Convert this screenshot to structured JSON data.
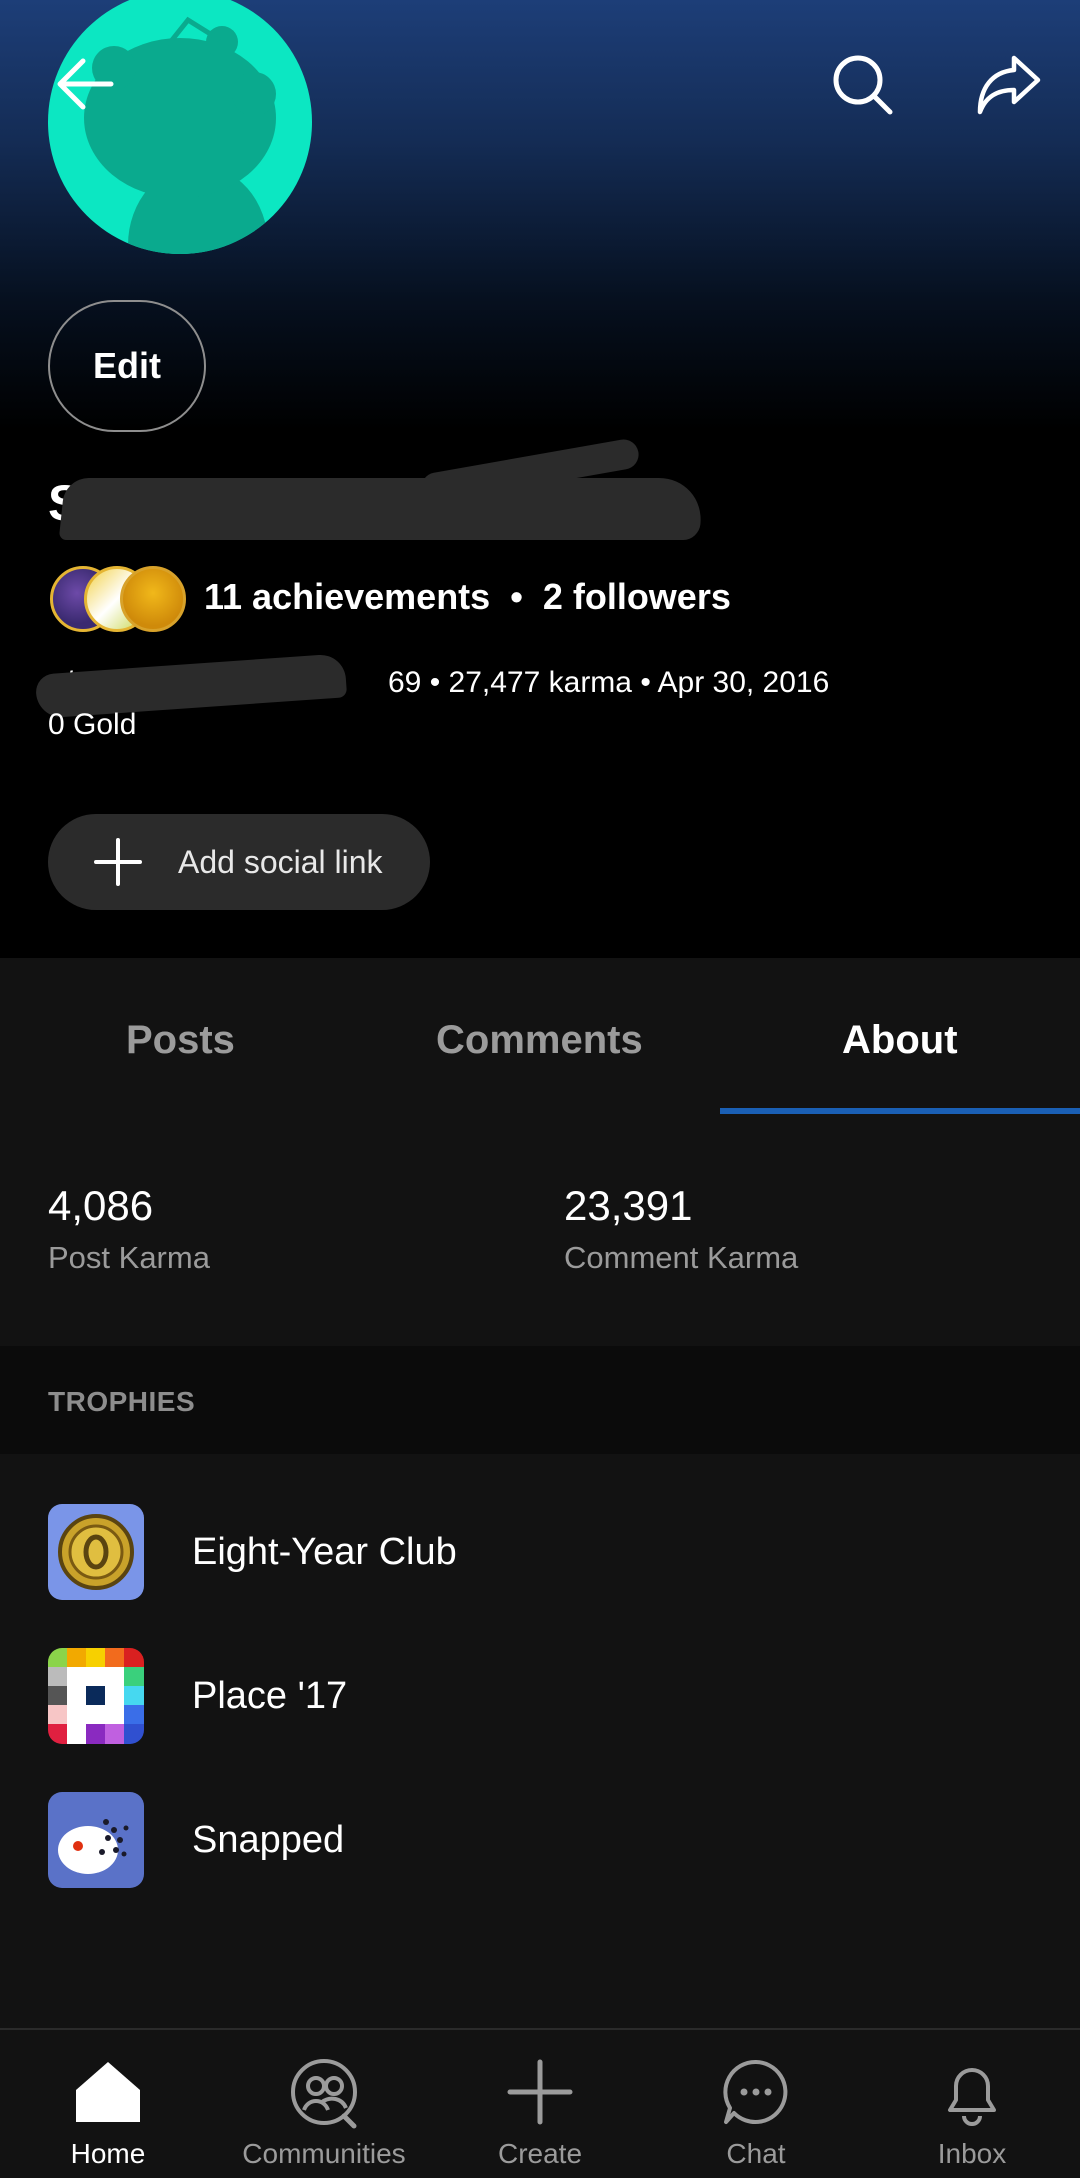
{
  "profile": {
    "display_name": "S",
    "edit_label": "Edit",
    "achievements": "11 achievements",
    "separator": "•",
    "followers": "2 followers",
    "username_prefix": "u/",
    "meta_suffix": "69 • 27,477 karma • Apr 30, 2016",
    "gold": "0 Gold",
    "add_social_link": "Add social link",
    "avatar_color": "#0ce7c2"
  },
  "tabs": [
    {
      "label": "Posts",
      "active": false
    },
    {
      "label": "Comments",
      "active": false
    },
    {
      "label": "About",
      "active": true
    }
  ],
  "karma": {
    "post_value": "4,086",
    "post_label": "Post Karma",
    "comment_value": "23,391",
    "comment_label": "Comment Karma"
  },
  "trophies": {
    "header": "TROPHIES",
    "items": [
      {
        "name": "Eight-Year Club",
        "icon": "coin-trophy-icon"
      },
      {
        "name": "Place '17",
        "icon": "pixel-grid-trophy-icon"
      },
      {
        "name": "Snapped",
        "icon": "snoo-snapped-trophy-icon"
      }
    ]
  },
  "bottom_nav": [
    {
      "label": "Home",
      "icon": "home-icon",
      "active": true
    },
    {
      "label": "Communities",
      "icon": "communities-icon",
      "active": false
    },
    {
      "label": "Create",
      "icon": "plus-icon",
      "active": false
    },
    {
      "label": "Chat",
      "icon": "chat-icon",
      "active": false
    },
    {
      "label": "Inbox",
      "icon": "bell-icon",
      "active": false
    }
  ],
  "colors": {
    "accent_blue": "#1a5fb4",
    "background": "#121212",
    "header_top": "#1d3e78"
  }
}
